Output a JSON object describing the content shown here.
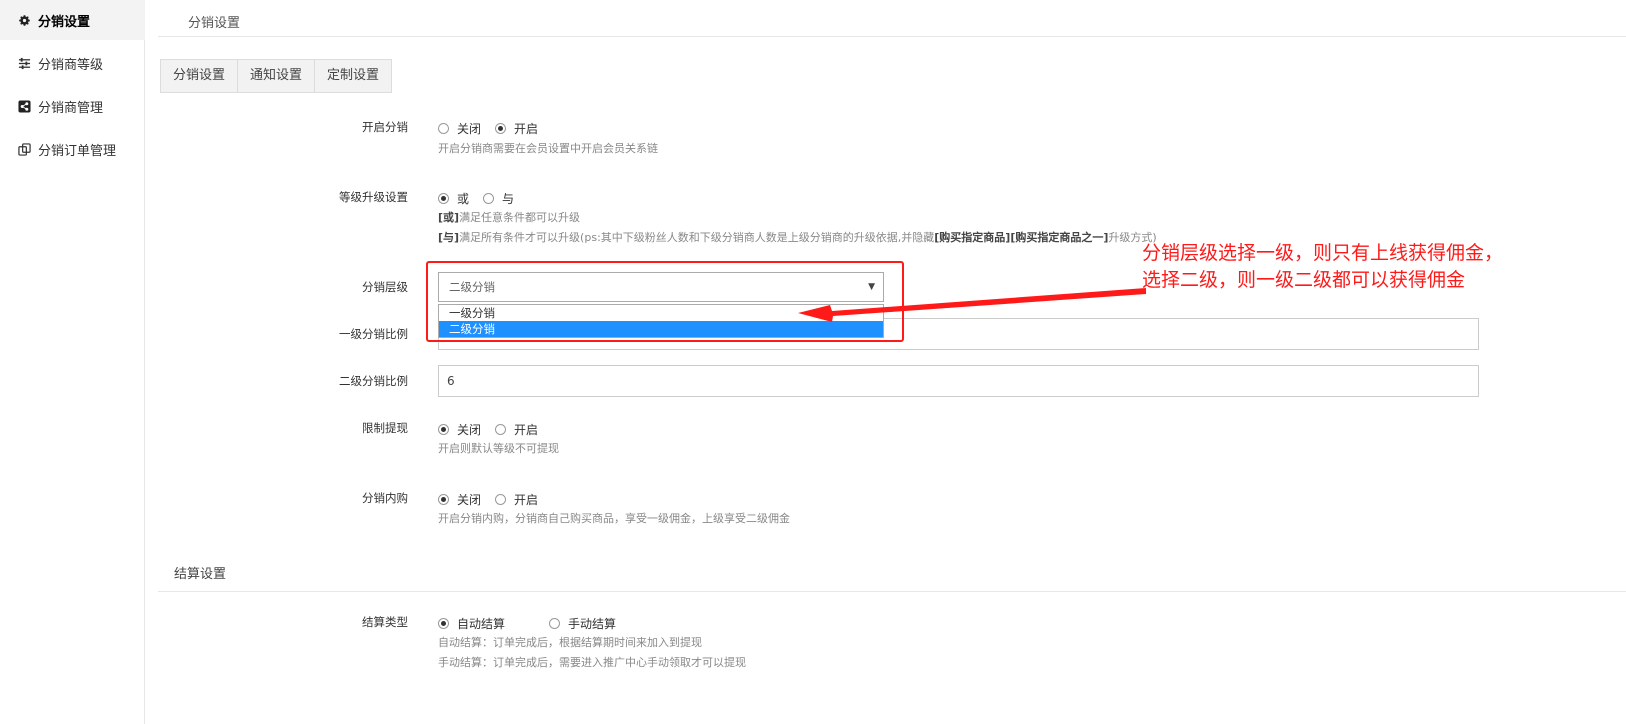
{
  "sidebar": {
    "items": [
      {
        "label": "分销设置",
        "icon": "gear-icon"
      },
      {
        "label": "分销商等级",
        "icon": "sliders-icon"
      },
      {
        "label": "分销商管理",
        "icon": "share-icon"
      },
      {
        "label": "分销订单管理",
        "icon": "orders-icon"
      }
    ]
  },
  "page_title": "分销设置",
  "tabs": [
    "分销设置",
    "通知设置",
    "定制设置"
  ],
  "form": {
    "enable": {
      "label": "开启分销",
      "opt_off": "关闭",
      "opt_on": "开启",
      "selected": "开启",
      "hint": "开启分销商需要在会员设置中开启会员关系链"
    },
    "upgrade": {
      "label": "等级升级设置",
      "opt_or": "或",
      "opt_and": "与",
      "selected": "或",
      "hint_or_tag": "[或]",
      "hint_or": "满足任意条件都可以升级",
      "hint_and_tag": "[与]",
      "hint_and": "满足所有条件才可以升级(ps:其中下级粉丝人数和下级分销商人数是上级分销商的升级依据,并隐藏",
      "hint_and_b1": "[购买指定商品]",
      "hint_and_b2": "[购买指定商品之一]",
      "hint_and_end": "升级方式)"
    },
    "level": {
      "label": "分销层级",
      "value": "二级分销",
      "options": [
        "一级分销",
        "二级分销"
      ],
      "highlighted": "二级分销"
    },
    "ratio1": {
      "label": "一级分销比例",
      "value": ""
    },
    "ratio2": {
      "label": "二级分销比例",
      "value": "6"
    },
    "withdraw": {
      "label": "限制提现",
      "opt_off": "关闭",
      "opt_on": "开启",
      "selected": "关闭",
      "hint": "开启则默认等级不可提现"
    },
    "self_buy": {
      "label": "分销内购",
      "opt_off": "关闭",
      "opt_on": "开启",
      "selected": "关闭",
      "hint": "开启分销内购，分销商自己购买商品，享受一级佣金，上级享受二级佣金"
    }
  },
  "settlement": {
    "section_title": "结算设置",
    "label": "结算类型",
    "opt_auto": "自动结算",
    "opt_manual": "手动结算",
    "selected": "自动结算",
    "hint_auto": "自动结算：订单完成后，根据结算期时间来加入到提现",
    "hint_manual": "手动结算：订单完成后，需要进入推广中心手动领取才可以提现"
  },
  "annotation": {
    "line1": "分销层级选择一级，则只有上线获得佣金，",
    "line2": "选择二级，则一级二级都可以获得佣金",
    "color": "#ff1a1a"
  }
}
